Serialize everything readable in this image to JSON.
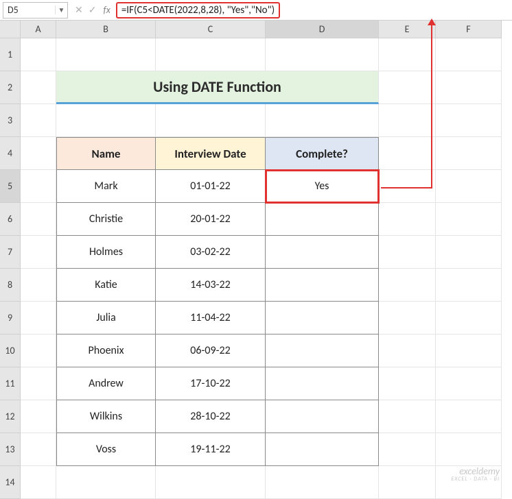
{
  "nameBox": "D5",
  "formula": "=IF(C5<DATE(2022,8,28), \"Yes\",\"No\")",
  "columns": [
    "A",
    "B",
    "C",
    "D",
    "E",
    "F"
  ],
  "rows": [
    "1",
    "2",
    "3",
    "4",
    "5",
    "6",
    "7",
    "8",
    "9",
    "10",
    "11",
    "12",
    "13",
    "14"
  ],
  "title": "Using DATE Function",
  "headers": {
    "name": "Name",
    "date": "Interview Date",
    "complete": "Complete?"
  },
  "chart_data": {
    "type": "table",
    "columns": [
      "Name",
      "Interview Date",
      "Complete?"
    ],
    "rows": [
      {
        "name": "Mark",
        "date": "01-01-22",
        "complete": "Yes"
      },
      {
        "name": "Christie",
        "date": "20-01-22",
        "complete": ""
      },
      {
        "name": "Holmes",
        "date": "03-02-22",
        "complete": ""
      },
      {
        "name": "Katie",
        "date": "14-03-22",
        "complete": ""
      },
      {
        "name": "Julia",
        "date": "11-04-22",
        "complete": ""
      },
      {
        "name": "Phoenix",
        "date": "06-09-22",
        "complete": ""
      },
      {
        "name": "Andrew",
        "date": "17-10-22",
        "complete": ""
      },
      {
        "name": "Wilkins",
        "date": "28-10-22",
        "complete": ""
      },
      {
        "name": "Voss",
        "date": "19-11-22",
        "complete": ""
      }
    ]
  },
  "watermark": {
    "brand": "exceldemy",
    "tag": "EXCEL · DATA · BI"
  }
}
